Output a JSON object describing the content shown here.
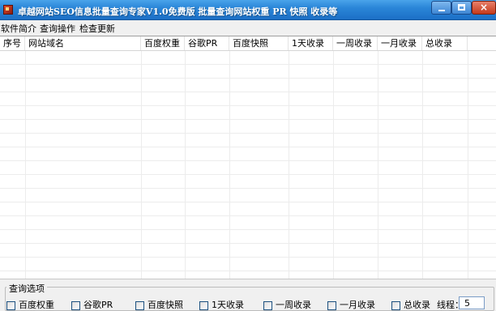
{
  "window": {
    "title": "卓越网站SEO信息批量查询专家V1.0免费版  批量查询网站权重 PR 快照 收录等",
    "close_glyph": "×"
  },
  "menu": [
    "软件简介",
    "查询操作",
    "检查更新"
  ],
  "table": {
    "columns": [
      "序号",
      "网站域名",
      "百度权重",
      "谷歌PR",
      "百度快照",
      "1天收录",
      "一周收录",
      "一月收录",
      "总收录"
    ],
    "rows": []
  },
  "options": {
    "group_label": "查询选项",
    "checkboxes": [
      "百度权重",
      "谷歌PR",
      "百度快照",
      "1天收录",
      "一周收录",
      "一月收录",
      "总收录"
    ],
    "thread_label": "线程：",
    "thread_value": "5"
  },
  "colors": {
    "titlebar": "#2a86d8",
    "background": "#f0f0f0",
    "grid_line": "#ececec"
  }
}
